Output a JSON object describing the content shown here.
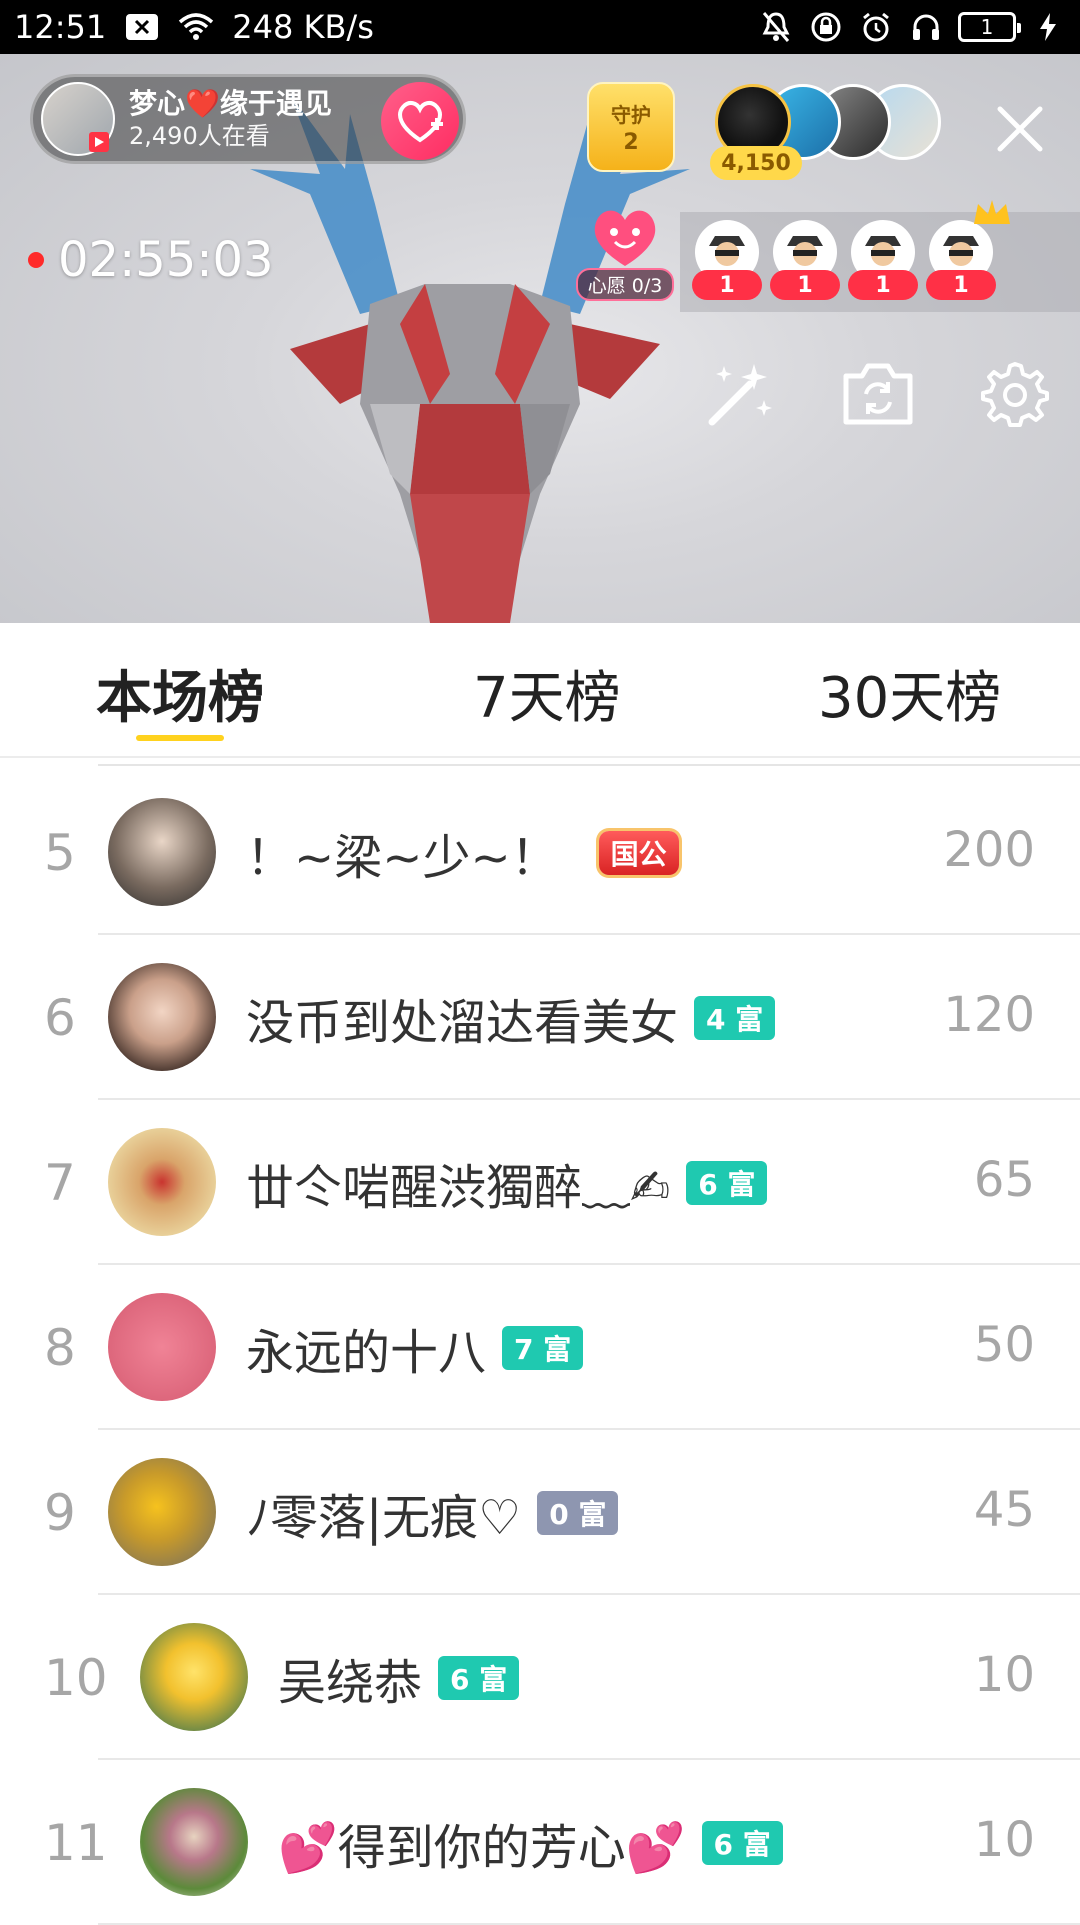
{
  "status_bar": {
    "time": "12:51",
    "net_speed": "248 KB/s",
    "battery": "1",
    "icons": [
      "notification-x-icon",
      "wifi-icon",
      "mute-bell-icon",
      "lock-rotation-icon",
      "alarm-icon",
      "headphones-icon",
      "battery-icon",
      "charging-icon"
    ]
  },
  "live": {
    "host_name": "梦心❤️缘于遇见",
    "viewers": "2,490人在看",
    "guard_label": "守护",
    "guard_count": "2",
    "top_coins": "4,150",
    "timer": "02:55:03",
    "wish_label": "心愿 0/3",
    "audience_badges": [
      "1",
      "1",
      "1",
      "1"
    ]
  },
  "tabs": [
    {
      "label": "本场榜",
      "active": true
    },
    {
      "label": "7天榜",
      "active": false
    },
    {
      "label": "30天榜",
      "active": false
    }
  ],
  "ranking": [
    {
      "rank": "5",
      "name": "！~梁~少~！",
      "level": "国公",
      "level_style": "red",
      "score": "200"
    },
    {
      "rank": "6",
      "name": "没币到处溜达看美女",
      "level": "4 富",
      "level_style": "teal",
      "score": "120"
    },
    {
      "rank": "7",
      "name": "丗仒啱醒渋獨醉﹏✍",
      "level": "6 富",
      "level_style": "teal",
      "score": "65"
    },
    {
      "rank": "8",
      "name": "永远的十八",
      "level": "7 富",
      "level_style": "teal",
      "score": "50"
    },
    {
      "rank": "9",
      "name": "ﾉ零落|无痕♡",
      "level": "0 富",
      "level_style": "gray",
      "score": "45"
    },
    {
      "rank": "10",
      "name": "吴绕恭",
      "level": "6 富",
      "level_style": "teal",
      "score": "10"
    },
    {
      "rank": "11",
      "name": "💕得到你的芳心💕",
      "level": "6 富",
      "level_style": "teal",
      "score": "10"
    }
  ],
  "colors": {
    "accent": "#ffd21e",
    "level_teal": "#1fc9b0",
    "level_gray": "#8e96b0",
    "follow_pink": "#ff2d62"
  }
}
